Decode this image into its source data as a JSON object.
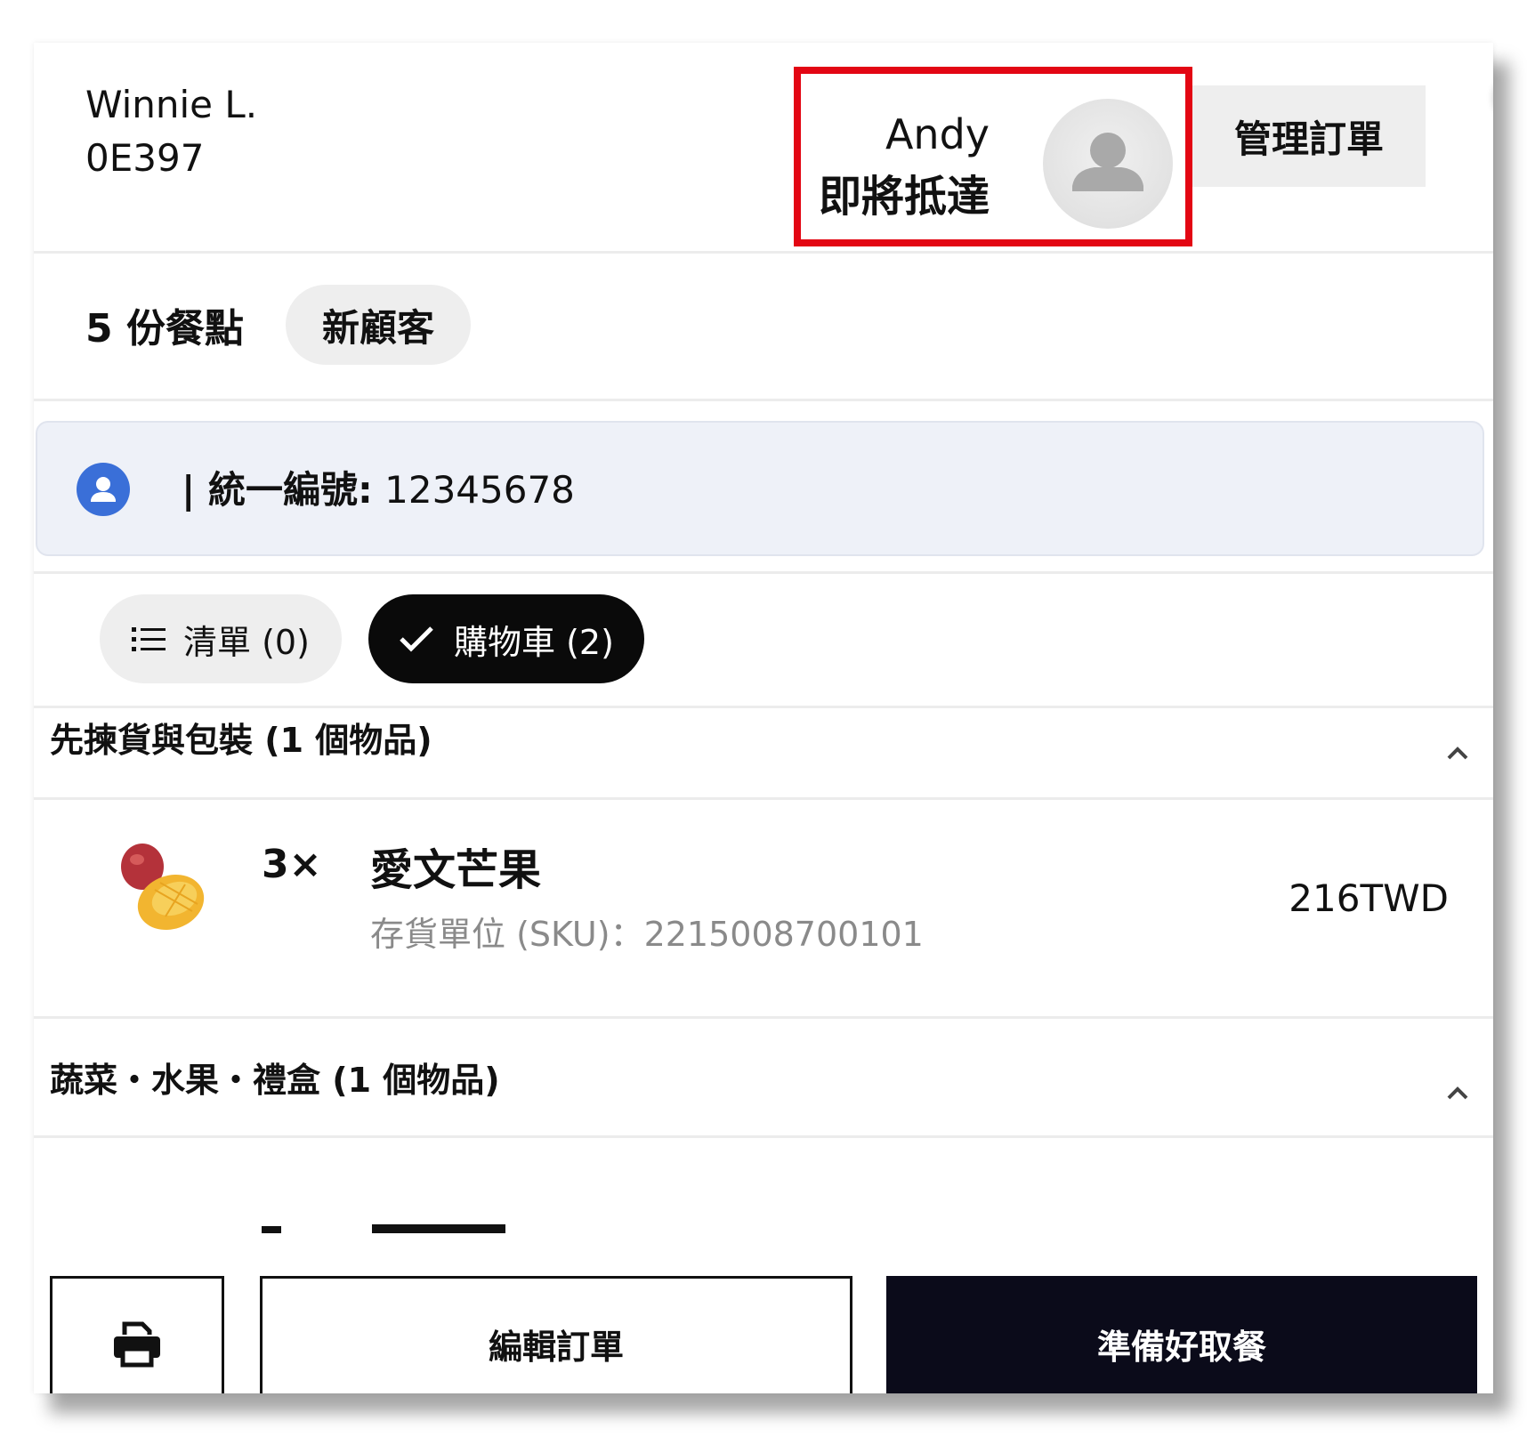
{
  "header": {
    "customer_name": "Winnie L.",
    "order_code": "0E397",
    "courier_name": "Andy",
    "courier_status": "即將抵達",
    "manage_order_label": "管理訂單",
    "highlight_color": "#e30613"
  },
  "summary": {
    "dish_count": "5 份餐點",
    "badge": "新顧客"
  },
  "tax_panel": {
    "icon": "person-circle-icon",
    "label": "| 統一編號:",
    "value": "12345678"
  },
  "tabs": [
    {
      "icon": "list-icon",
      "label": "清單 (0)",
      "selected": false
    },
    {
      "icon": "check-icon",
      "label": "購物車 (2)",
      "selected": true
    }
  ],
  "sections": [
    {
      "title": "先揀貨與包裝 (1 個物品)",
      "expanded": true,
      "items": [
        {
          "image": "mango-image",
          "qty": "3×",
          "name": "愛文芒果",
          "sku": "存貨單位 (SKU)：2215008700101",
          "price": "216TWD"
        }
      ]
    },
    {
      "title": "蔬菜・水果・禮盒 (1 個物品)",
      "expanded": true,
      "items": []
    }
  ],
  "actions": {
    "print_icon": "printer-icon",
    "edit_label": "編輯訂單",
    "ready_label": "準備好取餐"
  }
}
